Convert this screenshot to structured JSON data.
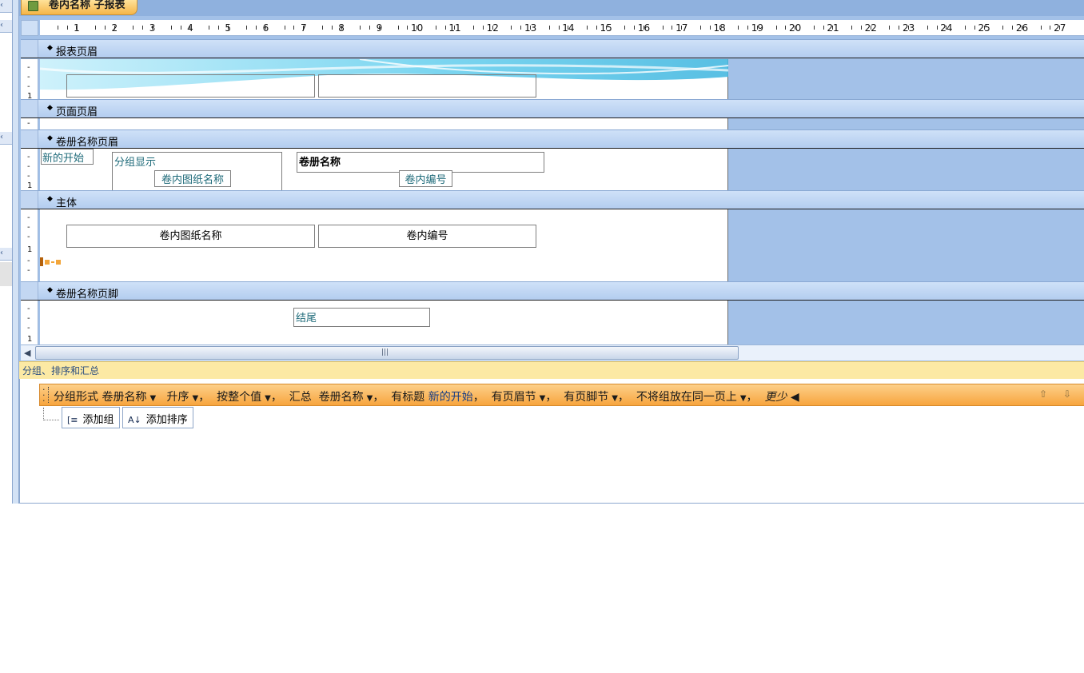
{
  "document_tab": {
    "title": "卷内名称 子报表",
    "icon": "report-icon"
  },
  "ruler": {
    "marks": [
      "1",
      "2",
      "3",
      "4",
      "5",
      "6",
      "7",
      "8",
      "9",
      "10",
      "11",
      "12",
      "13",
      "14",
      "15",
      "16",
      "17",
      "18",
      "19",
      "20",
      "21",
      "22",
      "23",
      "24",
      "25",
      "26",
      "27"
    ]
  },
  "sections": {
    "report_header": {
      "label": "报表页眉"
    },
    "page_header": {
      "label": "页面页眉"
    },
    "group_header": {
      "label": "卷册名称页眉"
    },
    "detail": {
      "label": "主体"
    },
    "group_footer": {
      "label": "卷册名称页脚"
    }
  },
  "controls": {
    "new_start": "新的开始",
    "group_display": "分组显示",
    "volume_name_bold": "卷册名称",
    "inner_drawing_name_small": "卷内图纸名称",
    "inner_number_small": "卷内编号",
    "inner_drawing_name": "卷内图纸名称",
    "inner_number": "卷内编号",
    "ending": "结尾"
  },
  "vruler": {
    "one": "1"
  },
  "group_sort_pane": {
    "title": "分组、排序和汇总",
    "row": {
      "group_form": "分组形式",
      "field": "卷册名称",
      "order": "升序",
      "by_whole_value": "按整个值",
      "totals_label": "汇总",
      "totals_field": "卷册名称",
      "with_title_label": "有标题",
      "with_title_value": "新的开始",
      "header_section": "有页眉节",
      "footer_section": "有页脚节",
      "keep_together": "不将组放在同一页上",
      "less": "更少"
    },
    "add_group": "添加组",
    "add_sort": "添加排序"
  },
  "colors": {
    "section_bar": "#b3cdef",
    "design_background": "#a3c1e8",
    "group_row": "#f7a53e",
    "pane_title_bg": "#fce9a4",
    "teal_text": "#1f6b7a"
  }
}
